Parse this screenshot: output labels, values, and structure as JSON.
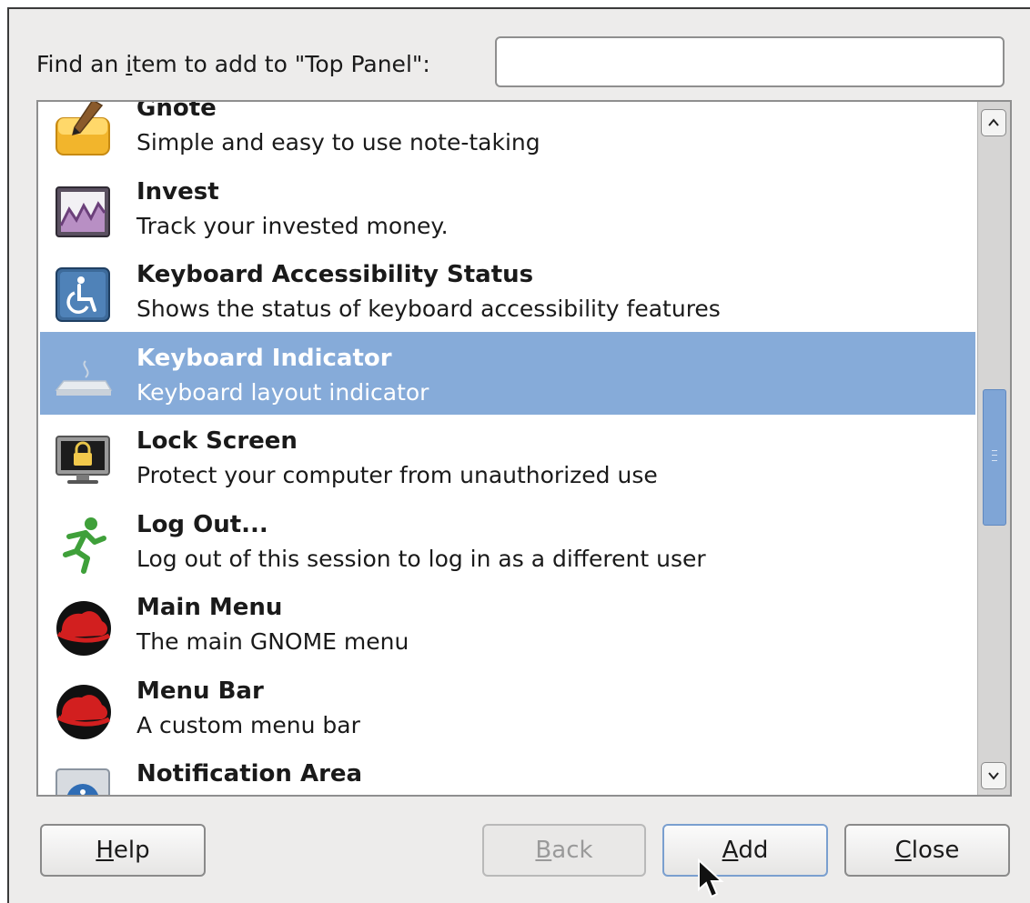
{
  "search": {
    "label_pre": "Find an ",
    "label_mnemonic": "i",
    "label_post": "tem to add to \"Top Panel\":",
    "value": ""
  },
  "items": [
    {
      "title": "Gnote",
      "description": "Simple and easy to use note-taking",
      "icon": "gnote-notepad-icon"
    },
    {
      "title": "Invest",
      "description": "Track your invested money.",
      "icon": "invest-chart-icon"
    },
    {
      "title": "Keyboard Accessibility Status",
      "description": "Shows the status of keyboard accessibility features",
      "icon": "accessibility-wheelchair-icon"
    },
    {
      "title": "Keyboard Indicator",
      "description": "Keyboard layout indicator",
      "icon": "keyboard-icon"
    },
    {
      "title": "Lock Screen",
      "description": "Protect your computer from unauthorized use",
      "icon": "lock-screen-monitor-icon"
    },
    {
      "title": "Log Out...",
      "description": "Log out of this session to log in as a different user",
      "icon": "log-out-running-man-icon"
    },
    {
      "title": "Main Menu",
      "description": "The main GNOME menu",
      "icon": "redhat-hat-icon"
    },
    {
      "title": "Menu Bar",
      "description": "A custom menu bar",
      "icon": "redhat-hat-icon"
    },
    {
      "title": "Notification Area",
      "description": "",
      "icon": "info-icon"
    }
  ],
  "selected_index": 3,
  "buttons": {
    "help": {
      "mnemonic": "H",
      "rest": "elp"
    },
    "back": {
      "mnemonic": "B",
      "rest": "ack",
      "enabled": false
    },
    "add": {
      "mnemonic": "A",
      "rest": "dd"
    },
    "close": {
      "mnemonic": "C",
      "rest": "lose"
    }
  },
  "colors": {
    "selection": "#86abd9",
    "scroll_thumb": "#7fa5d6",
    "dialog_bg": "#edeceb"
  }
}
